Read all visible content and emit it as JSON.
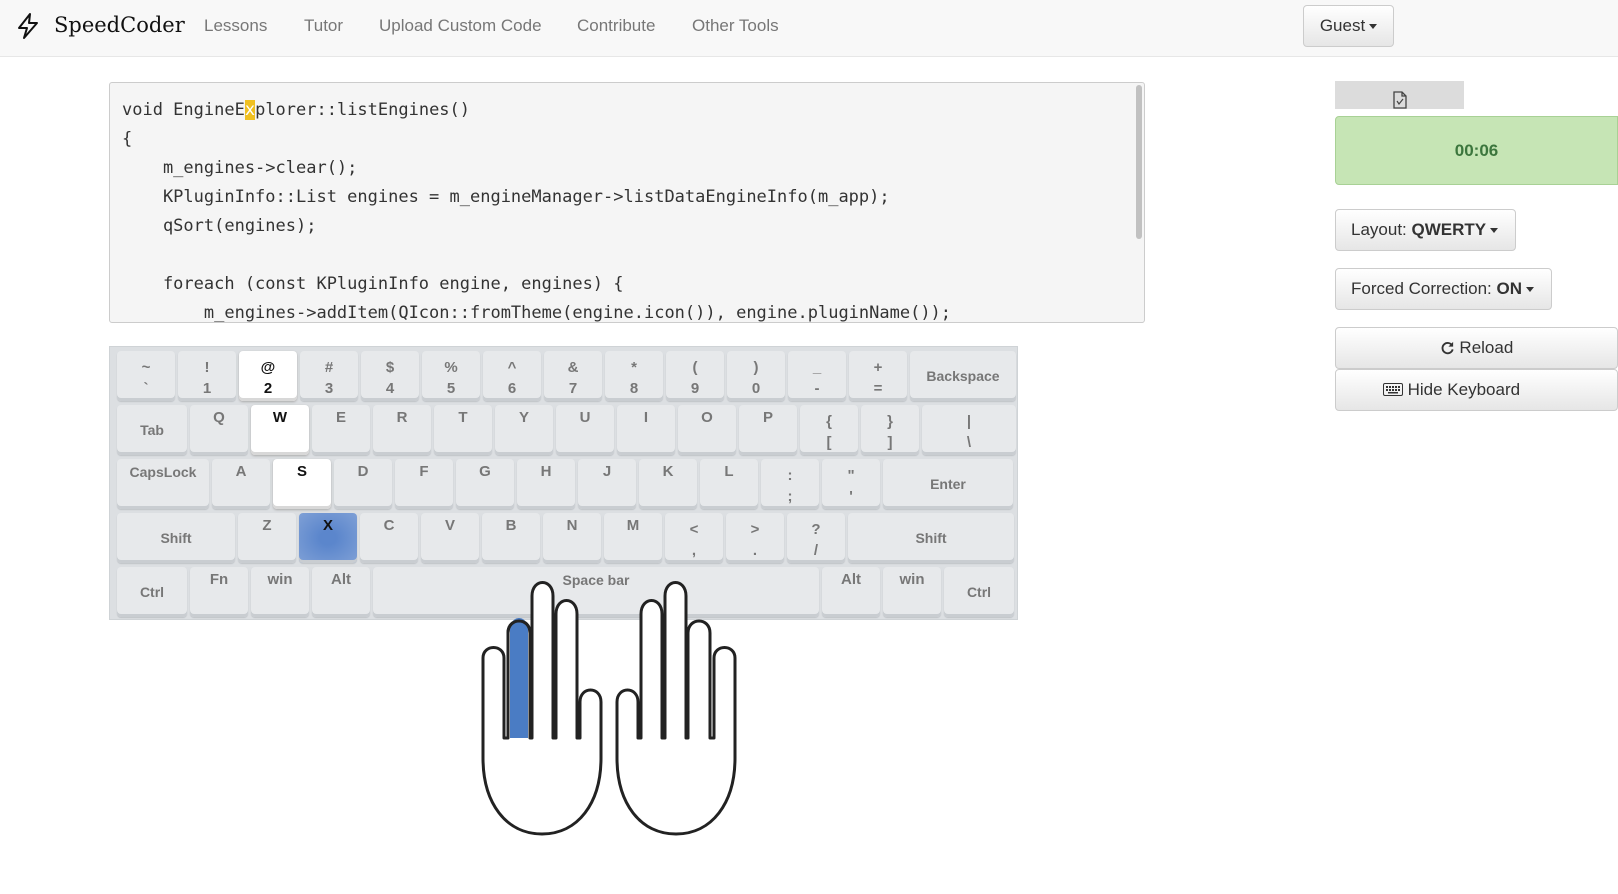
{
  "navbar": {
    "brand": "SpeedCoder",
    "links": [
      "Lessons",
      "Tutor",
      "Upload Custom Code",
      "Contribute",
      "Other Tools"
    ],
    "user_label": "Guest"
  },
  "code": {
    "lines": [
      {
        "before": "void EngineE",
        "cursor": "x",
        "after": "plorer::listEngines()"
      },
      {
        "before": "{",
        "cursor": "",
        "after": ""
      },
      {
        "before": "    m_engines->clear();",
        "cursor": "",
        "after": ""
      },
      {
        "before": "    KPluginInfo::List engines = m_engineManager->listDataEngineInfo(m_app);",
        "cursor": "",
        "after": ""
      },
      {
        "before": "    qSort(engines);",
        "cursor": "",
        "after": ""
      },
      {
        "before": "",
        "cursor": "",
        "after": ""
      },
      {
        "before": "    foreach (const KPluginInfo engine, engines) {",
        "cursor": "",
        "after": ""
      },
      {
        "before": "        m_engines->addItem(QIcon::fromTheme(engine.icon()), engine.pluginName());",
        "cursor": "",
        "after": ""
      }
    ]
  },
  "keyboard": {
    "rows": [
      [
        {
          "top": "~",
          "bottom": "`"
        },
        {
          "top": "!",
          "bottom": "1"
        },
        {
          "top": "@",
          "bottom": "2",
          "state": "home"
        },
        {
          "top": "#",
          "bottom": "3"
        },
        {
          "top": "$",
          "bottom": "4"
        },
        {
          "top": "%",
          "bottom": "5"
        },
        {
          "top": "^",
          "bottom": "6"
        },
        {
          "top": "&",
          "bottom": "7"
        },
        {
          "top": "*",
          "bottom": "8"
        },
        {
          "top": "(",
          "bottom": "9"
        },
        {
          "top": ")",
          "bottom": "0"
        },
        {
          "top": "_",
          "bottom": "-"
        },
        {
          "top": "+",
          "bottom": "="
        },
        {
          "label": "Backspace"
        }
      ],
      [
        {
          "label": "Tab"
        },
        {
          "top": "Q"
        },
        {
          "top": "W",
          "state": "home"
        },
        {
          "top": "E"
        },
        {
          "top": "R"
        },
        {
          "top": "T"
        },
        {
          "top": "Y"
        },
        {
          "top": "U"
        },
        {
          "top": "I"
        },
        {
          "top": "O"
        },
        {
          "top": "P"
        },
        {
          "top": "{",
          "bottom": "["
        },
        {
          "top": "}",
          "bottom": "]"
        },
        {
          "top": "|",
          "bottom": "\\"
        }
      ],
      [
        {
          "top": "CapsLock"
        },
        {
          "top": "A"
        },
        {
          "top": "S",
          "state": "home"
        },
        {
          "top": "D"
        },
        {
          "top": "F"
        },
        {
          "top": "G"
        },
        {
          "top": "H"
        },
        {
          "top": "J"
        },
        {
          "top": "K"
        },
        {
          "top": "L"
        },
        {
          "top": ":",
          "bottom": ";"
        },
        {
          "top": "\"",
          "bottom": "'"
        },
        {
          "label": "Enter"
        }
      ],
      [
        {
          "label": "Shift"
        },
        {
          "top": "Z"
        },
        {
          "top": "X",
          "state": "active"
        },
        {
          "top": "C"
        },
        {
          "top": "V"
        },
        {
          "top": "B"
        },
        {
          "top": "N"
        },
        {
          "top": "M"
        },
        {
          "top": "<",
          "bottom": ","
        },
        {
          "top": ">",
          "bottom": "."
        },
        {
          "top": "?",
          "bottom": "/"
        },
        {
          "label": "Shift"
        }
      ],
      [
        {
          "label": "Ctrl"
        },
        {
          "top": "Fn"
        },
        {
          "top": "win"
        },
        {
          "top": "Alt"
        },
        {
          "top": "Space bar"
        },
        {
          "top": "Alt"
        },
        {
          "top": "win"
        },
        {
          "label": "Ctrl"
        }
      ]
    ]
  },
  "hands": {
    "highlighted_finger": "left-middle",
    "highlight_color": "#4a7cc4"
  },
  "sidebar": {
    "doc_tab_icon": "document-icon",
    "timer": "00:06",
    "layout_prefix": "Layout: ",
    "layout_value": "QWERTY",
    "correction_prefix": "Forced Correction: ",
    "correction_value": "ON",
    "reload_label": "Reload",
    "hide_keyboard_label": "Hide Keyboard"
  }
}
